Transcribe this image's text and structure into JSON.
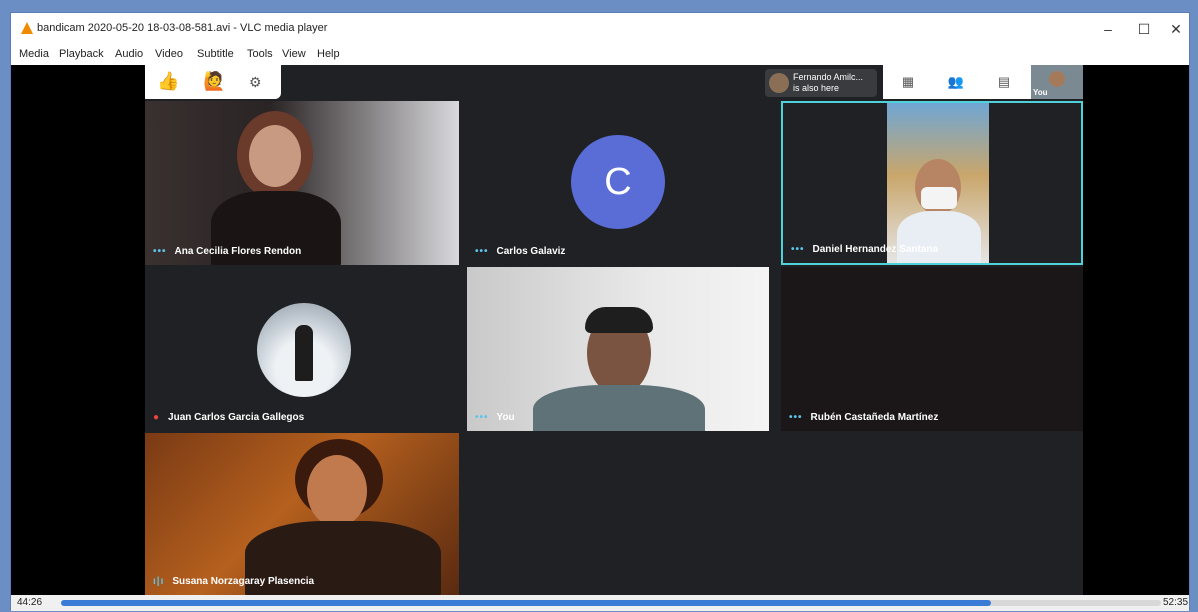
{
  "window": {
    "title": "bandicam 2020-05-20 18-03-08-581.avi - VLC media player",
    "minimize": "–",
    "maximize": "☐",
    "close": "✕"
  },
  "menu": [
    "Media",
    "Playback",
    "Audio",
    "Video",
    "Subtitle",
    "Tools",
    "View",
    "Help"
  ],
  "reactions": {
    "thumbs_up": "👍",
    "raise_hand": "🙋",
    "settings": "⚙"
  },
  "notification": {
    "name": "Fernando Amilc...",
    "text": "is also here"
  },
  "toolbar": {
    "grid_icon": "▦",
    "people_icon": "👥",
    "chat_icon": "▤"
  },
  "self_thumb_label": "You",
  "tiles": [
    {
      "name": "Ana Cecilia Flores Rendon"
    },
    {
      "name": "Carlos Galaviz",
      "avatar_letter": "C"
    },
    {
      "name": "Daniel Hernandez Santana"
    },
    {
      "name": "Juan Carlos Garcia Gallegos"
    },
    {
      "name": "You"
    },
    {
      "name": "Rubén Castañeda Martínez"
    },
    {
      "name": "Susana Norzagaray Plasencia"
    }
  ],
  "playback": {
    "elapsed": "44:26",
    "total": "52:35",
    "progress": 0.845
  },
  "colors": {
    "meet_bg": "#202124",
    "active_border": "#4fd1d9",
    "accent": "#5ec3e8",
    "avatar_c": "#5a6dd6"
  }
}
